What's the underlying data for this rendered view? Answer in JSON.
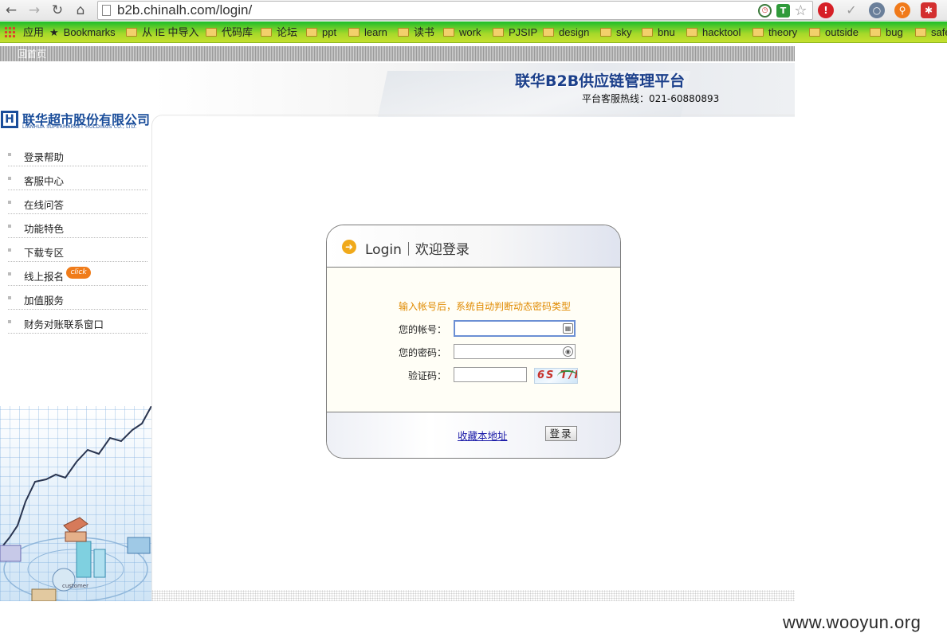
{
  "browser": {
    "back_icon": "back-arrow-icon",
    "forward_icon": "forward-arrow-icon",
    "reload_icon": "reload-icon",
    "home_icon": "home-icon",
    "url": "b2b.chinalh.com/login/",
    "extensions": [
      "clock-icon",
      "shield-icon",
      "star-icon",
      "stop-icon",
      "check-icon",
      "circle-icon",
      "search-icon",
      "puzzle-icon"
    ]
  },
  "bookmarks": {
    "apps_label": "应用",
    "items": [
      "Bookmarks",
      "从 IE 中导入",
      "代码库",
      "论坛",
      "ppt",
      "learn",
      "读书",
      "work",
      "PJSIP",
      "design",
      "sky",
      "bnu",
      "hacktool",
      "theory",
      "outside",
      "bug",
      "safe"
    ]
  },
  "page": {
    "topstrip_text": "回首页",
    "site_title": "联华B2B供应链管理平台",
    "hotline": "平台客服热线：021-60880893",
    "logo": {
      "mark": "H",
      "cn": "联华超市股份有限公司",
      "en": "LIANHUA SUPERMARKET HOLDINGS CO., LTD."
    },
    "sidebar": {
      "items": [
        {
          "label": "登录帮助"
        },
        {
          "label": "客服中心"
        },
        {
          "label": "在线问答"
        },
        {
          "label": "功能特色"
        },
        {
          "label": "下载专区"
        },
        {
          "label": "线上报名",
          "badge": "click"
        },
        {
          "label": "加值服务"
        },
        {
          "label": "财务对账联系窗口"
        }
      ],
      "art_label": "customer"
    },
    "login": {
      "title": "Login｜欢迎登录",
      "hint": "输入帐号后，系统自动判断动态密码类型",
      "account_label": "您的帐号：",
      "password_label": "您的密码：",
      "captcha_label": "验证码：",
      "account_value": "",
      "password_value": "",
      "captcha_value": "",
      "captcha_image_text": "6S T/F",
      "favorite_link": "收藏本地址",
      "submit_label": "登录"
    },
    "watermark": "www.wooyun.org"
  },
  "colors": {
    "bookmark_bar": "#9fd52a",
    "title_blue": "#1b3f8a",
    "hint_orange": "#e08a00",
    "badge_orange": "#f07c1a"
  }
}
